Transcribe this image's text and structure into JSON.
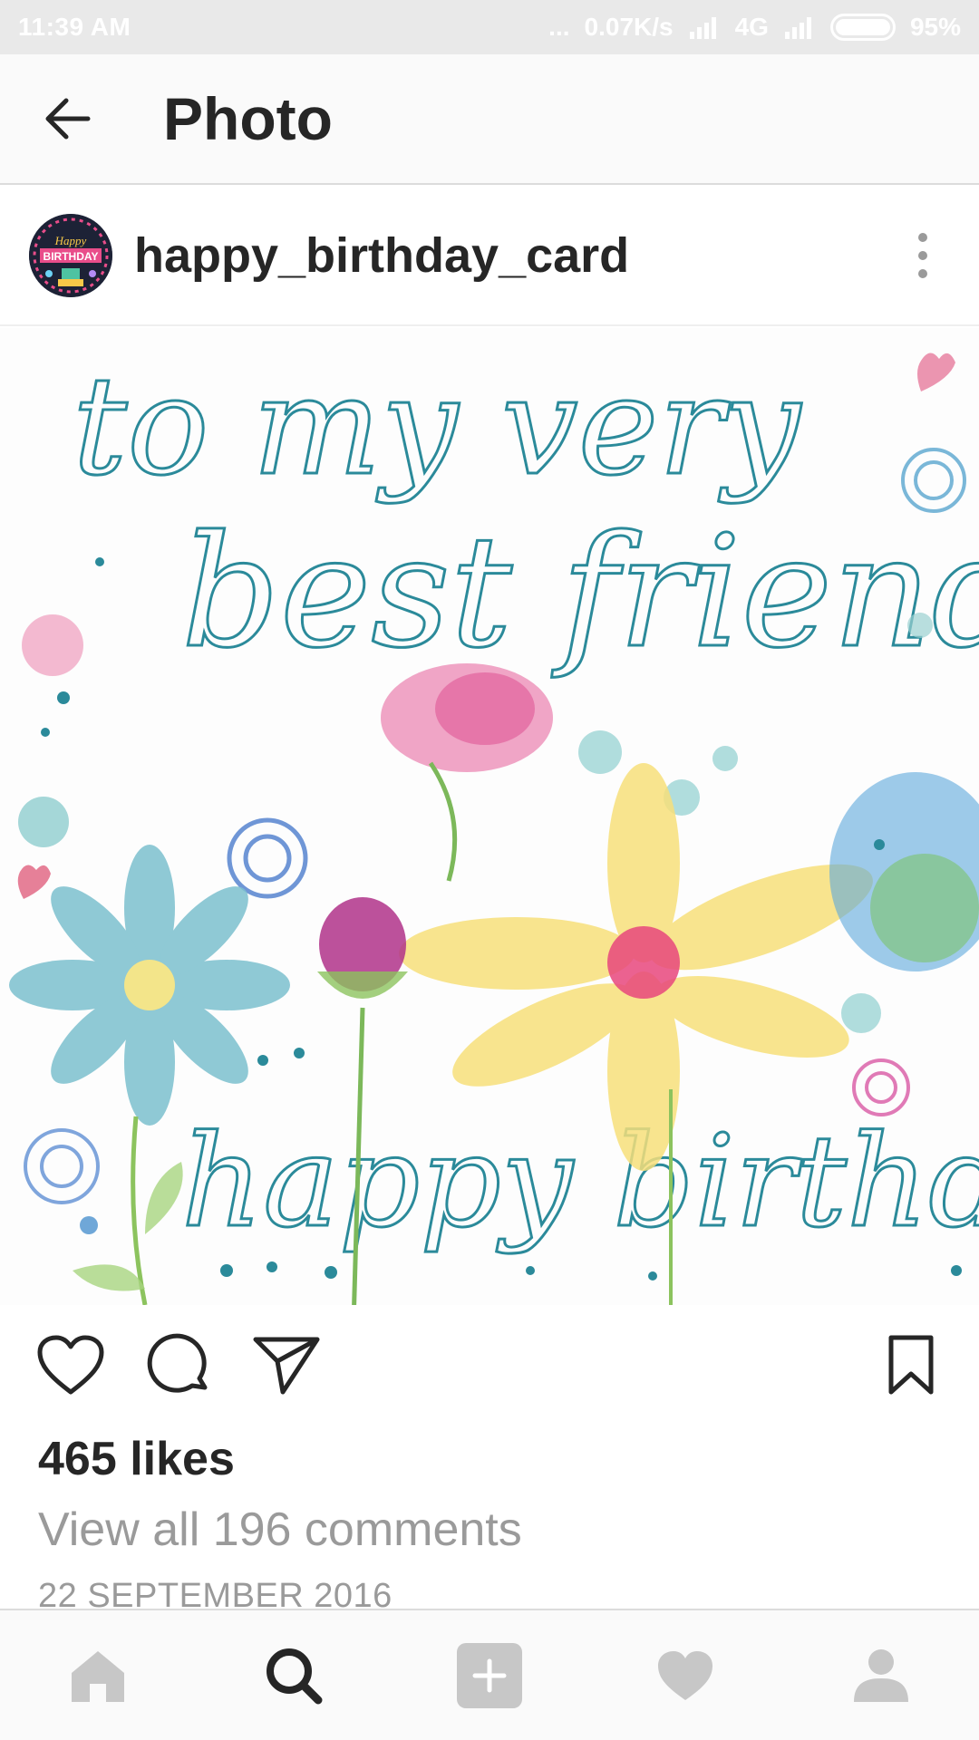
{
  "status_bar": {
    "time": "11:39 AM",
    "dots": "...",
    "net_speed": "0.07K/s",
    "network": "4G",
    "battery": "95%"
  },
  "app_bar": {
    "title": "Photo"
  },
  "post": {
    "username": "happy_birthday_card",
    "avatar_text_top": "Happy",
    "avatar_text_bottom": "BIRTHDAY",
    "image": {
      "line1": "to my very",
      "line2": "best friend",
      "line3": "happy birthday"
    },
    "likes": "465 likes",
    "view_comments": "View all 196 comments",
    "date": "22 SEPTEMBER 2016"
  },
  "icons": {
    "back": "arrow-left-icon",
    "more": "more-vertical-icon",
    "like": "heart-icon",
    "comment": "comment-icon",
    "share": "send-icon",
    "save": "bookmark-icon",
    "nav": [
      "home-icon",
      "search-icon",
      "add-icon",
      "activity-heart-icon",
      "profile-icon"
    ]
  },
  "colors": {
    "text": "#262626",
    "muted": "#9a9a9a",
    "nav_inactive": "#c7c7c7",
    "ink": "#2b8a9a"
  }
}
